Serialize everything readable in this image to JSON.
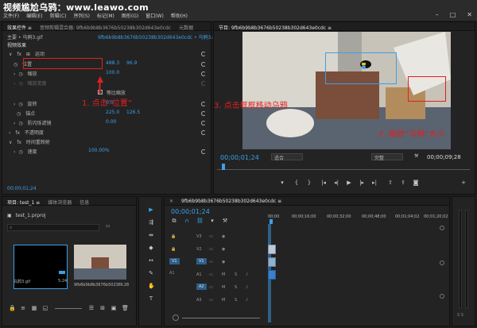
{
  "window": {
    "watermark": "视频尴尬乌鸦：www.leawo.com",
    "menu": [
      "文件(F)",
      "编辑(E)",
      "剪辑(C)",
      "序列(S)",
      "标记(M)",
      "图形(G)",
      "窗口(W)",
      "帮助(H)"
    ]
  },
  "effect_controls": {
    "tabs": [
      "效果控件 ≡",
      "音频剪辑混合器: 9fb6b9b8b3676b50238b302d643e0cdc",
      "元数据"
    ],
    "source_label": "主要 • 乌鸦3.gif",
    "sequence_label": "9fb6b9b8b3676b50238b302d643e0cdc • 乌鸦3.gif",
    "section_video": "视频效果",
    "motion": "运动",
    "position_label": "位置",
    "position_x": "488.3",
    "position_y": "96.9",
    "scale_label": "缩放",
    "scale_value": "100.0",
    "scale_width_label": "缩放宽度",
    "uniform_scale": "等比缩放",
    "rotation_label": "旋转",
    "rotation_value": "0.0",
    "anchor_label": "锚点",
    "anchor_x": "225.0",
    "anchor_y": "126.5",
    "flicker_label": "防闪烁滤镜",
    "flicker_value": "0.00",
    "opacity_label": "不透明度",
    "remap_label": "时间重映射",
    "speed_label": "速度",
    "speed_value": "100.00%",
    "timecode": "00;00;01;24"
  },
  "annotations": {
    "step1": "1. 点击“位置”",
    "step2": "2. 缩放“乌鸦”大小",
    "step3": "3. 点击框框移动乌鸦"
  },
  "program_monitor": {
    "title": "节目: 9fb6b9b8b3676b50238b302d643e0cdc ≡",
    "timecode": "00;00;01;24",
    "fit": "适合",
    "quality": "完整",
    "duration": "00;00;09;28"
  },
  "project": {
    "tabs": [
      "项目: test_1 ≡",
      "媒体浏览器",
      "信息"
    ],
    "file": "test_1.prproj",
    "item1_name": "乌鸦3.gif",
    "item1_duration": "5:24",
    "item2_name": "9fb6b9b8b3676b50238b302d643e0...",
    "item2_duration": "9:28"
  },
  "timeline": {
    "title": "9fb6b9b8b3676b50238b302d643e0cdc ≡",
    "timecode": "00;00;01;24",
    "ruler": [
      "00;00",
      "00;00;16;00",
      "00;00;32;00",
      "00;00;48;00",
      "00;01;04;02",
      "00;01;20;02"
    ],
    "video_tracks": [
      "V3",
      "V2",
      "V1"
    ],
    "audio_tracks": [
      "A1",
      "A2",
      "A3"
    ],
    "source_v": "V1",
    "source_a": "A1"
  },
  "colors": {
    "accent": "#3ca0e8",
    "annotation": "#e02020",
    "clip_video": "#9fb4c8",
    "clip_audio": "#4a8ad0"
  }
}
